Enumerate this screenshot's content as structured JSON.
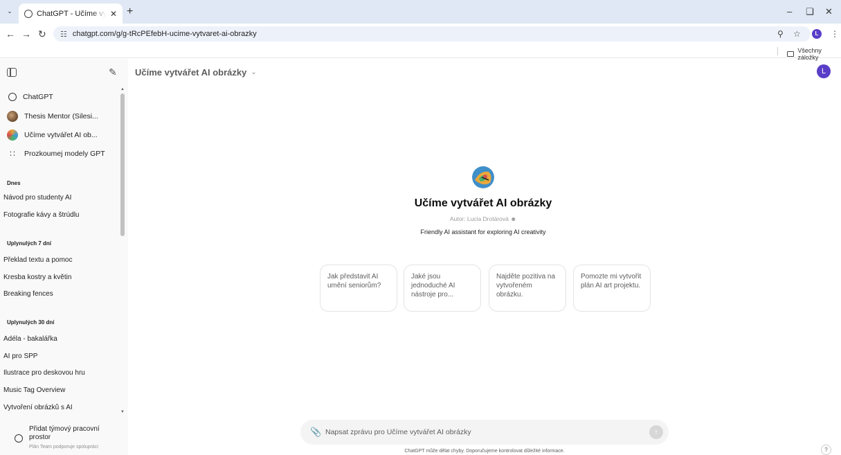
{
  "browser": {
    "tab_title": "ChatGPT - Učíme vytvářet AI obrázky",
    "url": "chatgpt.com/g/g-tRcPEfebH-ucime-vytvaret-ai-obrazky",
    "profile_letter": "L",
    "bookmarks_folder": "Všechny záložky"
  },
  "sidebar": {
    "gpts": [
      {
        "label": "ChatGPT",
        "icon": "chatgpt-logo-icon"
      },
      {
        "label": "Thesis Mentor (Silesi...",
        "icon": "avatar"
      },
      {
        "label": "Učíme vytvářet AI ob...",
        "icon": "avatar"
      },
      {
        "label": "Prozkoumej modely GPT",
        "icon": "grid-icon"
      }
    ],
    "sections": [
      {
        "title": "Dnes",
        "items": [
          "Návod pro studenty AI",
          "Fotografie kávy a štrúdlu"
        ]
      },
      {
        "title": "Uplynulých 7 dní",
        "items": [
          "Překlad textu a pomoc",
          "Kresba kostry a květin",
          "Breaking fences"
        ]
      },
      {
        "title": "Uplynulých 30 dní",
        "items": [
          "Adéla - bakalářka",
          "AI pro SPP",
          "Ilustrace pro deskovou hru",
          "Music Tag Overview",
          "Vytvoření obrázků s AI"
        ]
      }
    ],
    "team": {
      "title": "Přidat týmový pracovní prostor",
      "subtitle": "Plán Team podporuje spolupráci"
    }
  },
  "main": {
    "header_title": "Učíme vytvářet AI obrázky",
    "user_letter": "L",
    "gpt": {
      "title": "Učíme vytvářet AI obrázky",
      "author": "Autor: Lucia Drotárová",
      "description": "Friendly AI assistant for exploring AI creativity"
    },
    "starters": [
      "Jak představit AI umění seniorům?",
      "Jaké jsou jednoduché AI nástroje pro...",
      "Najděte pozitiva na vytvořeném obrázku.",
      "Pomozte mi vytvořit plán AI art projektu."
    ],
    "composer_placeholder": "Napsat zprávu pro Učíme vytvářet AI obrázky",
    "disclaimer": "ChatGPT může dělat chyby. Doporučujeme kontrolovat důležité informace.",
    "help": "?"
  },
  "colors": {
    "accent": "#5a3ec8",
    "sidebar_bg": "#f9f9f9",
    "tabstrip_bg": "#dfe8f4"
  }
}
